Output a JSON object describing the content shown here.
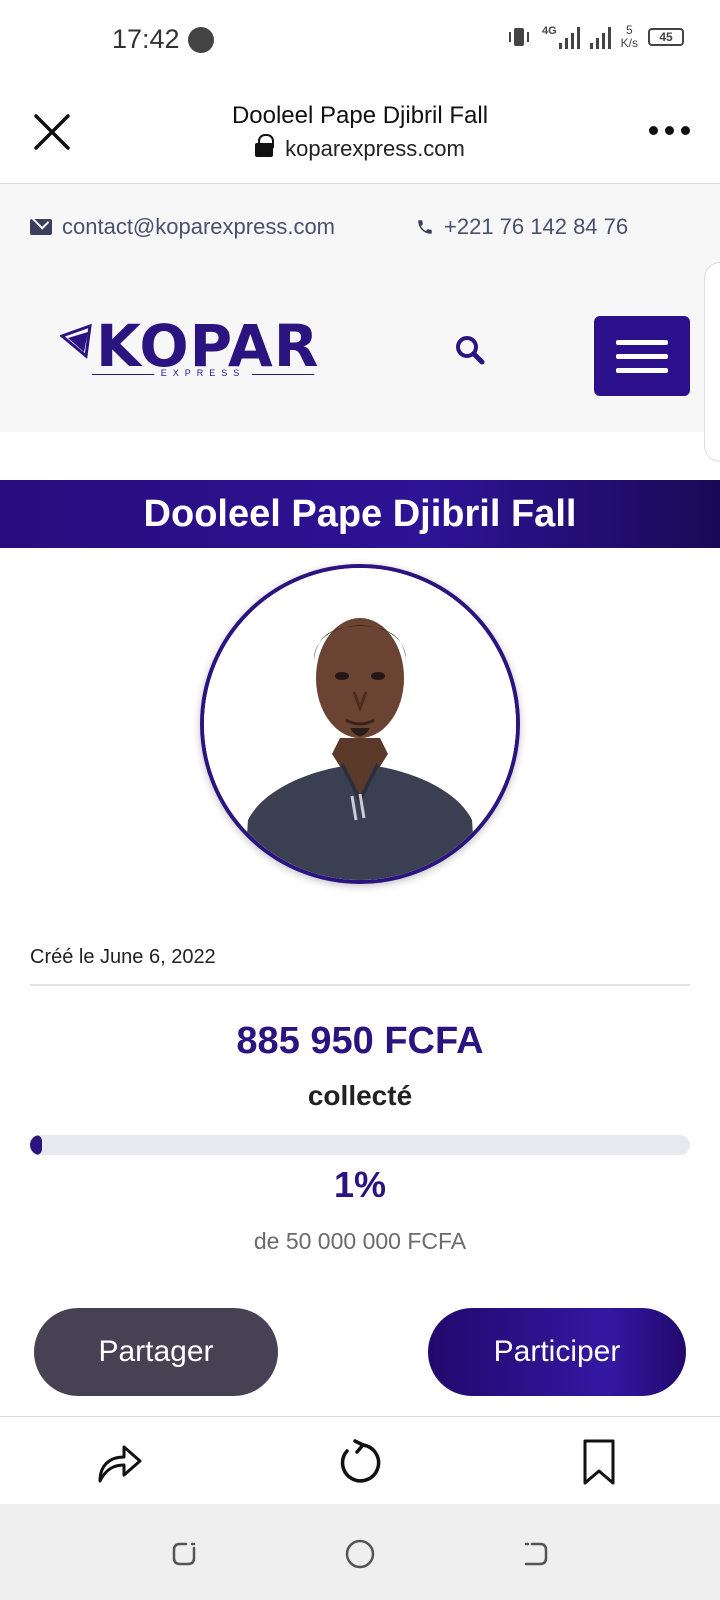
{
  "status_bar": {
    "time": "17:42",
    "network": "4G",
    "speed_value": "5",
    "speed_unit": "K/s",
    "battery": "45"
  },
  "browser": {
    "page_title": "Dooleel Pape Djibril Fall",
    "url": "koparexpress.com"
  },
  "site_header": {
    "email": "contact@koparexpress.com",
    "phone": "+221 76 142 84 76",
    "logo_text": "KOPAR",
    "logo_subtext": "EXPRESS"
  },
  "campaign": {
    "title": "Dooleel Pape Djibril Fall",
    "created": "Créé le June 6, 2022",
    "amount": "885 950 FCFA",
    "collected_label": "collecté",
    "progress_fraction": 0.0177,
    "percent": "1%",
    "goal": "de 50 000 000 FCFA",
    "share_label": "Partager",
    "participate_label": "Participer"
  },
  "colors": {
    "brand": "#2c1480",
    "share_button": "#464254"
  },
  "icons": [
    "whatsapp-icon",
    "close-icon",
    "lock-icon",
    "more-icon",
    "envelope-icon",
    "phone-icon",
    "search-icon",
    "hamburger-menu-icon",
    "share-icon",
    "reload-icon",
    "bookmark-icon",
    "recents-icon",
    "home-icon",
    "back-icon"
  ]
}
